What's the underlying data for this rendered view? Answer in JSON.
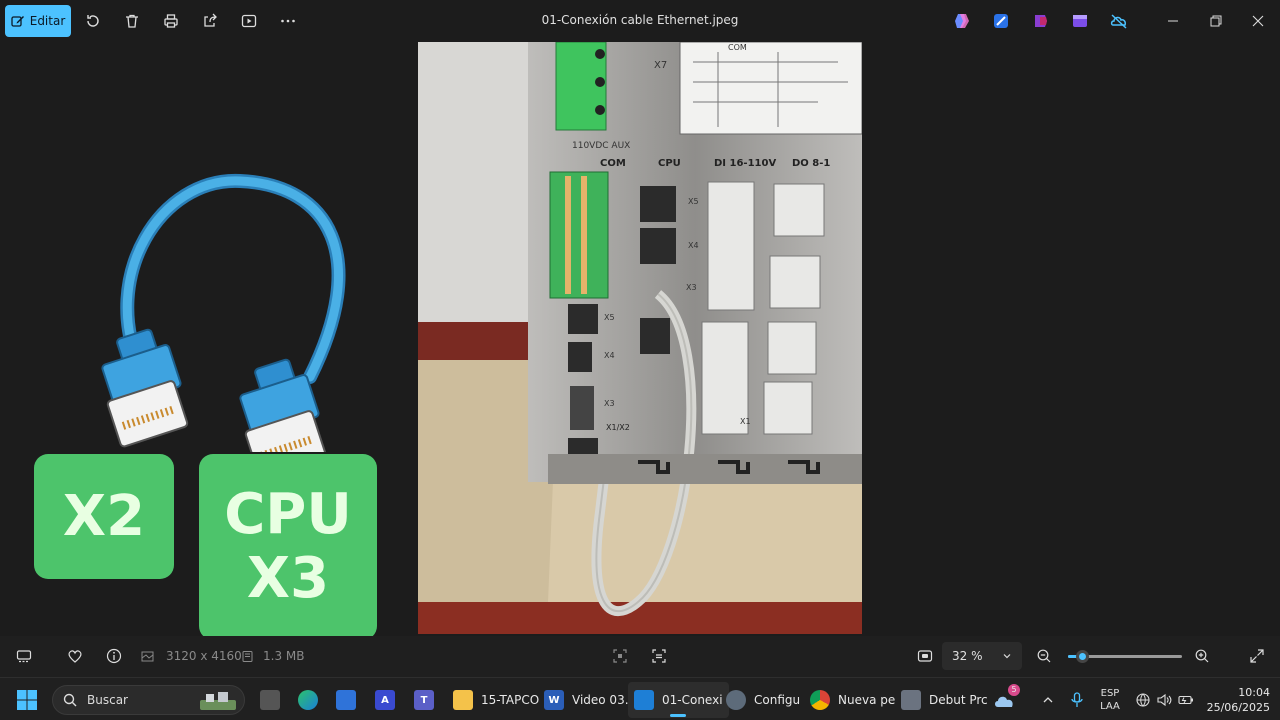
{
  "toolbar": {
    "edit_label": "Editar",
    "title": "01-Conexión cable Ethernet.jpeg"
  },
  "overlay": {
    "badge_x2": "X2",
    "badge_cpu_line1": "CPU",
    "badge_cpu_line2": "X3"
  },
  "photo": {
    "label_com_top": "COM",
    "label_x7": "X7",
    "label_aux": "110VDC AUX",
    "label_com": "COM",
    "label_cpu": "CPU",
    "label_di": "DI 16-110V",
    "label_do": "DO 8-1",
    "label_x5": "X5",
    "label_x4": "X4",
    "label_x3": "X3",
    "label_x5b": "X5",
    "label_x4b": "X4",
    "label_x3b": "X3",
    "label_x1x2": "X1/X2",
    "label_x1": "X1"
  },
  "statusbar": {
    "dimensions": "3120 x 4160",
    "filesize": "1.3 MB",
    "zoom": "32 %",
    "zoom_fraction": 0.08
  },
  "taskbar": {
    "search_placeholder": "Buscar",
    "items": [
      {
        "label": "15-TAPCO"
      },
      {
        "label": "Video 03."
      },
      {
        "label": "01-Conexi"
      },
      {
        "label": "Configu"
      },
      {
        "label": "Nueva pe"
      },
      {
        "label": "Debut Prc"
      }
    ],
    "notification_count": "5",
    "lang_top": "ESP",
    "lang_bottom": "LAA",
    "time": "10:04",
    "date": "25/06/2025"
  },
  "colors": {
    "accent": "#4cc2ff",
    "badge_green": "#4dc46b",
    "cable_blue": "#3b9fd8"
  }
}
